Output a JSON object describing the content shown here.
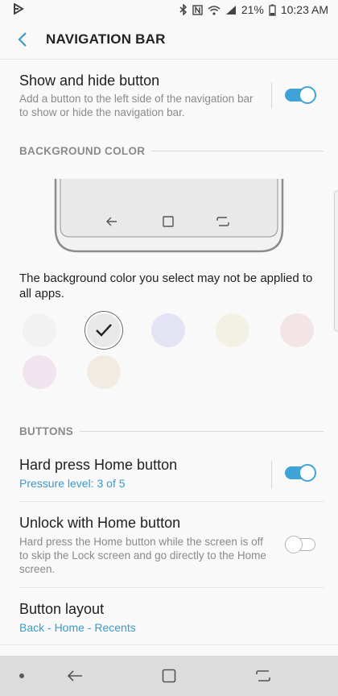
{
  "status_bar": {
    "battery": "21%",
    "time": "10:23 AM",
    "icons": [
      "play-store-notification-icon",
      "bluetooth-icon",
      "nfc-icon",
      "wifi-icon",
      "signal-icon",
      "battery-icon"
    ]
  },
  "app_bar": {
    "title": "NAVIGATION BAR",
    "back_icon": "back-arrow-icon"
  },
  "show_hide": {
    "title": "Show and hide button",
    "description": "Add a button to the left side of the navigation bar to show or hide the navigation bar.",
    "enabled": true
  },
  "background_color": {
    "header": "BACKGROUND COLOR",
    "note": "The background color you select may not be applied to all apps.",
    "selected_index": 1,
    "swatches": [
      {
        "color": "#f2f2f2"
      },
      {
        "color": "#e9e9e9"
      },
      {
        "color": "#e3e3f3"
      },
      {
        "color": "#f2f1e3"
      },
      {
        "color": "#f3e5e5"
      },
      {
        "color": "#f0e5ef"
      },
      {
        "color": "#f1ebe4"
      }
    ]
  },
  "buttons_section": {
    "header": "BUTTONS",
    "hard_press": {
      "title": "Hard press Home button",
      "subtitle": "Pressure level: 3 of 5",
      "enabled": true
    },
    "unlock": {
      "title": "Unlock with Home button",
      "description": "Hard press the Home button while the screen is off to skip the Lock screen and go directly to the Home screen.",
      "enabled": false
    },
    "layout": {
      "title": "Button layout",
      "subtitle": "Back - Home - Recents"
    }
  },
  "colors": {
    "accent": "#3fa3d8",
    "link": "#3a9bcb",
    "navbar": "#dcdcdc"
  }
}
